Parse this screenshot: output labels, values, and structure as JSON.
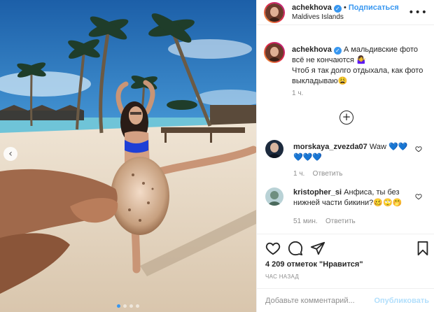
{
  "post": {
    "username": "achekhova",
    "follow_label": "Подписаться",
    "location": "Maldives Islands",
    "caption_line1": "А мальдивские фото",
    "caption_emoji1": "🤷‍♀️",
    "caption_line2": "всё не кончаются",
    "caption_line3": "Чтоб я так долго отдыхала, как фото",
    "caption_line4": "выкладываю",
    "caption_emoji2": "😩",
    "caption_time": "1 ч.",
    "likes": "4 209 отметок \"Нравится\"",
    "posted_ago": "ЧАС НАЗАД",
    "comment_placeholder": "Добавьте комментарий...",
    "publish_label": "Опубликовать",
    "carousel_prev": "‹",
    "load_more": "+"
  },
  "comments": [
    {
      "username": "morskaya_zvezda07",
      "text_line1": "Waw 💙💙",
      "text_line2": "💙💙💙",
      "time": "1 ч.",
      "reply_label": "Ответить"
    },
    {
      "username": "kristopher_si",
      "text_line1": "Анфиса, ты без",
      "text_line2": "нижней части бикини?🥴🙄🤭",
      "time": "51 мин.",
      "reply_label": "Ответить"
    }
  ],
  "carousel": {
    "total": 4,
    "active_index": 0
  },
  "colors": {
    "accent": "#3897f0",
    "publish_disabled": "#b2dffc",
    "muted": "#8e8e8e"
  }
}
